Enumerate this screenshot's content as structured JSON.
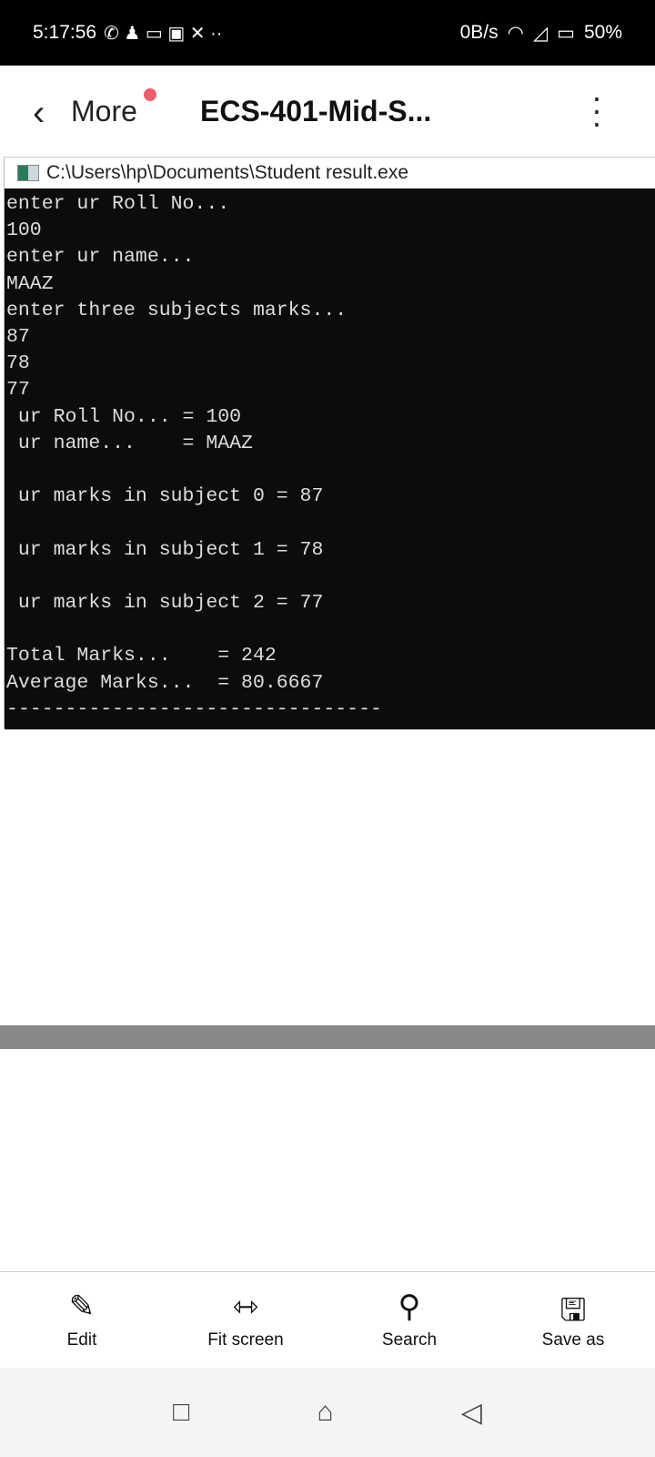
{
  "status": {
    "time": "5:17:56",
    "speed": "0B/s",
    "battery": "50%"
  },
  "appbar": {
    "back_label": "More",
    "title": "ECS-401-Mid-S..."
  },
  "window": {
    "title": "C:\\Users\\hp\\Documents\\Student result.exe"
  },
  "console": {
    "lines": [
      "enter ur Roll No...",
      "100",
      "enter ur name...",
      "MAAZ",
      "enter three subjects marks...",
      "87",
      "78",
      "77",
      " ur Roll No... = 100",
      " ur name...    = MAAZ",
      "",
      " ur marks in subject 0 = 87",
      "",
      " ur marks in subject 1 = 78",
      "",
      " ur marks in subject 2 = 77",
      "",
      "Total Marks...    = 242",
      "Average Marks...  = 80.6667",
      "--------------------------------"
    ]
  },
  "toolbar": {
    "edit": "Edit",
    "fit": "Fit screen",
    "search": "Search",
    "save": "Save as"
  }
}
